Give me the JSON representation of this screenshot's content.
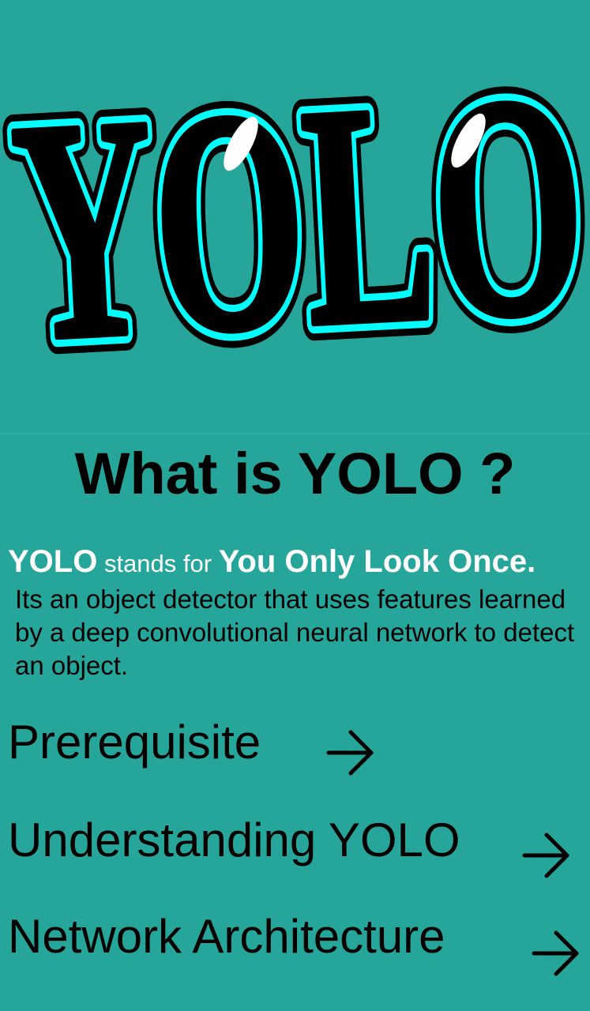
{
  "logo": {
    "text": "YOLO",
    "outline_color": "#00ffff",
    "fill_color": "#000000",
    "highlight_color": "#ffffff"
  },
  "heading": {
    "title": "What is YOLO ?"
  },
  "intro": {
    "term": "YOLO",
    "connector": " stands for ",
    "expansion": "You Only Look Once.",
    "description": "Its an object detector that uses features learned by a deep convolutional neural network to detect an object."
  },
  "nav": {
    "items": [
      {
        "label": "Prerequisite",
        "icon": "arrow-right-icon"
      },
      {
        "label": "Understanding YOLO",
        "icon": "arrow-right-icon"
      },
      {
        "label": "Network Architecture",
        "icon": "arrow-right-icon"
      }
    ]
  },
  "colors": {
    "background": "#26a69a",
    "text_primary": "#000000",
    "text_inverse": "#ffffff"
  }
}
